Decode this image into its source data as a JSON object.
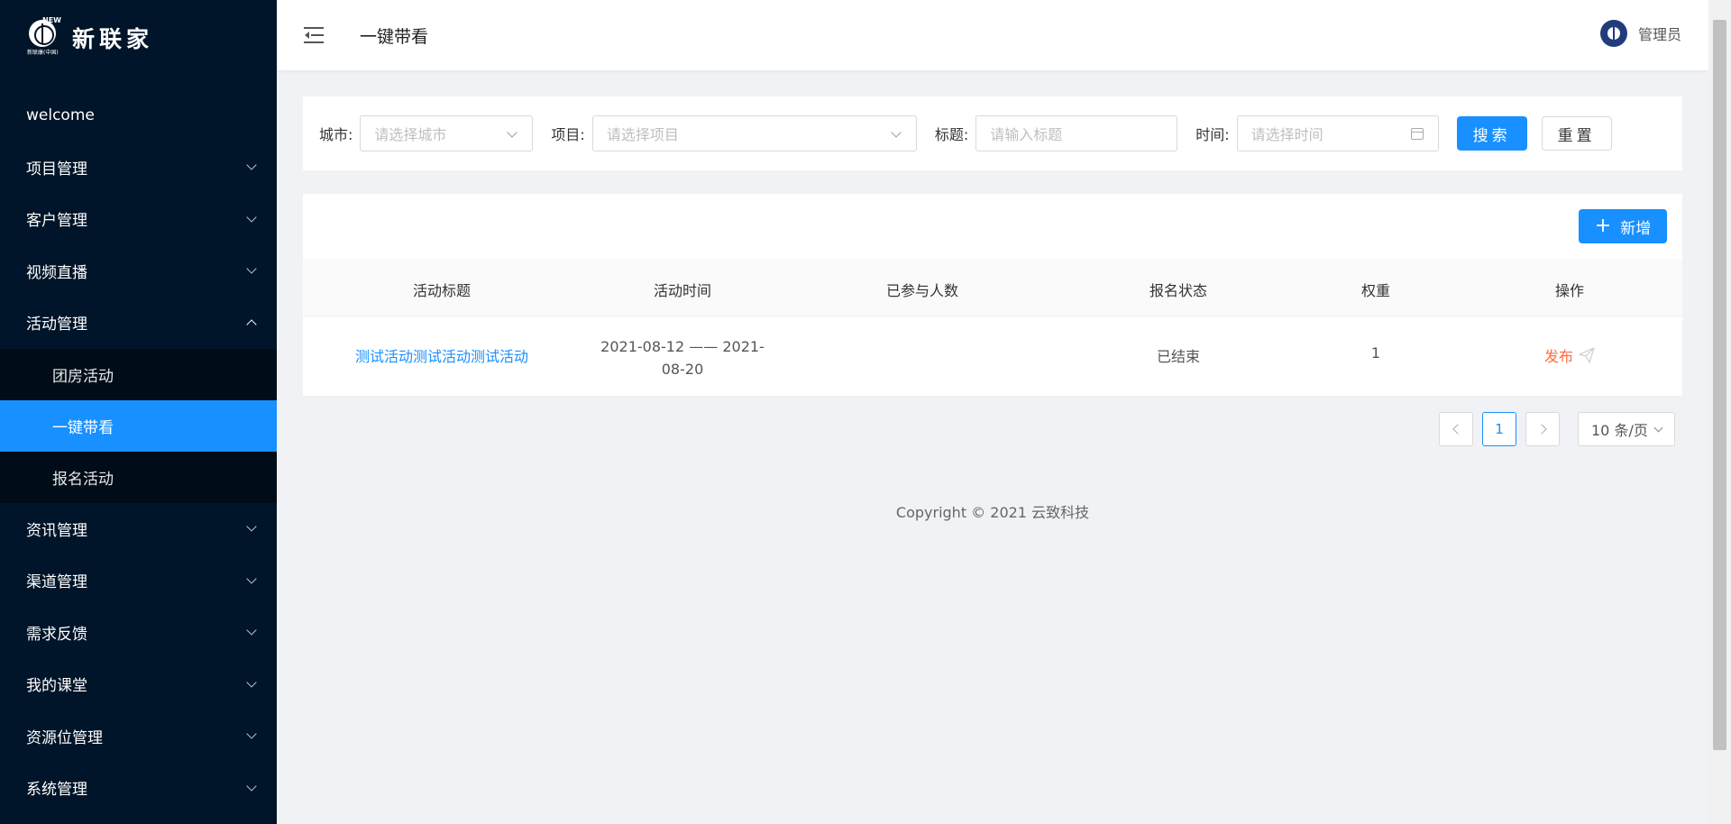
{
  "brand": {
    "name": "新联家",
    "logo_new": "NEW",
    "logo_sub": "新联康(中国)"
  },
  "sidebar": {
    "items": [
      {
        "label": "welcome"
      },
      {
        "label": "项目管理"
      },
      {
        "label": "客户管理"
      },
      {
        "label": "视频直播"
      },
      {
        "label": "活动管理",
        "expanded": true,
        "children": [
          {
            "label": "团房活动"
          },
          {
            "label": "一键带看",
            "active": true
          },
          {
            "label": "报名活动"
          }
        ]
      },
      {
        "label": "资讯管理"
      },
      {
        "label": "渠道管理"
      },
      {
        "label": "需求反馈"
      },
      {
        "label": "我的课堂"
      },
      {
        "label": "资源位管理"
      },
      {
        "label": "系统管理"
      }
    ]
  },
  "header": {
    "title": "一键带看",
    "user": "管理员"
  },
  "search": {
    "city_label": "城市:",
    "city_placeholder": "请选择城市",
    "project_label": "项目:",
    "project_placeholder": "请选择项目",
    "title_label": "标题:",
    "title_placeholder": "请输入标题",
    "time_label": "时间:",
    "time_placeholder": "请选择时间",
    "search_btn": "搜索",
    "reset_btn": "重置"
  },
  "table": {
    "add_btn": "新增",
    "columns": [
      "活动标题",
      "活动时间",
      "已参与人数",
      "报名状态",
      "权重",
      "操作"
    ],
    "rows": [
      {
        "title": "测试活动测试活动测试活动",
        "time": "2021-08-12 —— 2021-08-20",
        "participants": "",
        "status": "已结束",
        "weight": "1",
        "action": "发布"
      }
    ]
  },
  "pagination": {
    "current": "1",
    "page_size": "10 条/页"
  },
  "footer": "Copyright © 2021 云致科技",
  "colors": {
    "sidebar_bg": "#001529",
    "primary": "#1890ff",
    "publish": "#ff6b3d"
  }
}
